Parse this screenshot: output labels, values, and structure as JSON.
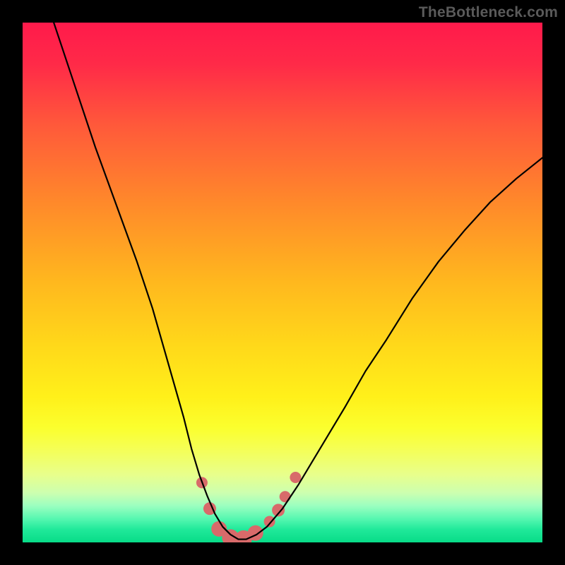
{
  "watermark": "TheBottleneck.com",
  "chart_data": {
    "type": "line",
    "title": "",
    "xlabel": "",
    "ylabel": "",
    "xlim": [
      0,
      100
    ],
    "ylim": [
      0,
      100
    ],
    "background_gradient_stops": [
      {
        "offset": 0.0,
        "color": "#ff1a4b"
      },
      {
        "offset": 0.08,
        "color": "#ff2a48"
      },
      {
        "offset": 0.2,
        "color": "#ff5a3a"
      },
      {
        "offset": 0.35,
        "color": "#ff8a2a"
      },
      {
        "offset": 0.5,
        "color": "#ffb81e"
      },
      {
        "offset": 0.62,
        "color": "#ffd81a"
      },
      {
        "offset": 0.72,
        "color": "#fff01a"
      },
      {
        "offset": 0.78,
        "color": "#fbff2e"
      },
      {
        "offset": 0.82,
        "color": "#f5ff55"
      },
      {
        "offset": 0.87,
        "color": "#e8ff8c"
      },
      {
        "offset": 0.905,
        "color": "#ccffb0"
      },
      {
        "offset": 0.93,
        "color": "#9affc0"
      },
      {
        "offset": 0.955,
        "color": "#55f7b0"
      },
      {
        "offset": 0.975,
        "color": "#20e99a"
      },
      {
        "offset": 1.0,
        "color": "#08dC88"
      }
    ],
    "series": [
      {
        "name": "bottleneck-curve",
        "stroke": "#000000",
        "stroke_width": 2.2,
        "x": [
          6.0,
          10,
          14,
          18,
          22,
          25,
          27,
          29,
          31,
          32.5,
          34,
          35.5,
          37,
          38.5,
          40,
          41.5,
          43,
          45,
          47,
          50,
          53,
          56,
          59,
          62,
          66,
          70,
          75,
          80,
          85,
          90,
          95,
          100
        ],
        "y": [
          100,
          88,
          76,
          65,
          54,
          45,
          38,
          31,
          24,
          18,
          13,
          9,
          5.5,
          3,
          1.5,
          0.6,
          0.6,
          1.5,
          3.0,
          6.5,
          11,
          16,
          21,
          26,
          33,
          39,
          47,
          54,
          60,
          65.5,
          70,
          74
        ]
      }
    ],
    "markers": {
      "name": "highlight-dots",
      "fill": "#d86a6a",
      "stroke": "#c95a5a",
      "points": [
        {
          "x": 34.5,
          "y": 11.5,
          "r": 8
        },
        {
          "x": 36.0,
          "y": 6.5,
          "r": 9
        },
        {
          "x": 37.8,
          "y": 2.6,
          "r": 11
        },
        {
          "x": 40.0,
          "y": 0.9,
          "r": 12
        },
        {
          "x": 42.5,
          "y": 0.7,
          "r": 12
        },
        {
          "x": 44.8,
          "y": 1.8,
          "r": 11
        },
        {
          "x": 47.5,
          "y": 4.0,
          "r": 8
        },
        {
          "x": 49.2,
          "y": 6.2,
          "r": 9
        },
        {
          "x": 50.5,
          "y": 8.8,
          "r": 8
        },
        {
          "x": 52.5,
          "y": 12.5,
          "r": 8
        }
      ]
    }
  }
}
